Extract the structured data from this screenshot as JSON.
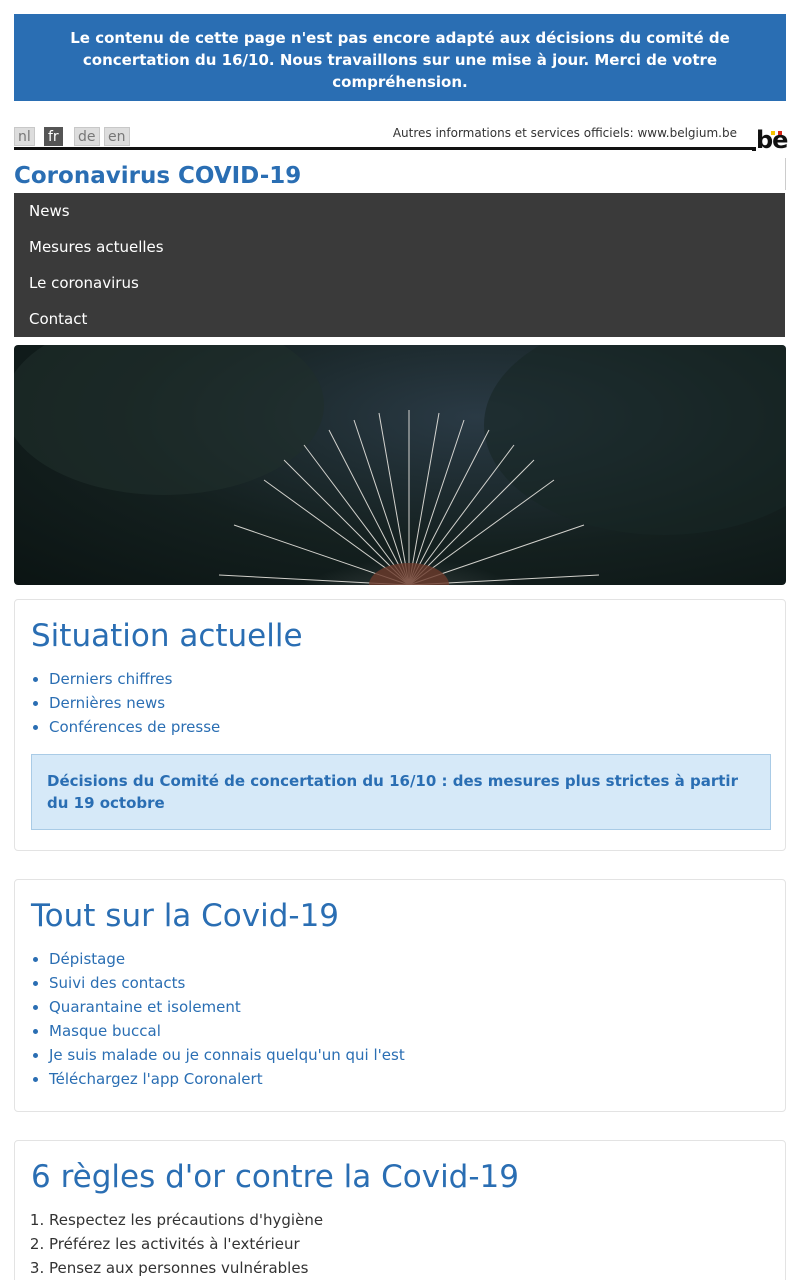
{
  "banner": {
    "text": "Le contenu de cette page n'est pas encore adapté aux décisions du comité de concertation du 16/10. Nous travaillons sur une mise à jour. Merci de votre compréhension."
  },
  "languages": [
    {
      "code": "nl",
      "active": false
    },
    {
      "code": "fr",
      "active": true
    },
    {
      "code": "de",
      "active": false
    },
    {
      "code": "en",
      "active": false
    }
  ],
  "header": {
    "official_label": "Autres informations et services officiels: ",
    "official_link": "www.belgium.be",
    "logo_text": "be",
    "site_title": "Coronavirus COVID-19"
  },
  "nav": {
    "items": [
      {
        "label": "News"
      },
      {
        "label": "Mesures actuelles"
      },
      {
        "label": "Le coronavirus"
      },
      {
        "label": "Contact"
      }
    ]
  },
  "situation": {
    "title": "Situation actuelle",
    "links": [
      {
        "label": "Derniers chiffres"
      },
      {
        "label": "Dernières news"
      },
      {
        "label": "Conférences de presse"
      }
    ],
    "notice": "Décisions du Comité de concertation du 16/10 : des mesures plus strictes à partir du 19 octobre"
  },
  "covid": {
    "title": "Tout sur la Covid-19",
    "links": [
      {
        "label": "Dépistage"
      },
      {
        "label": "Suivi des contacts"
      },
      {
        "label": "Quarantaine et isolement"
      },
      {
        "label": "Masque buccal"
      },
      {
        "label": "Je suis malade ou je connais quelqu'un qui l'est"
      },
      {
        "label": "Téléchargez l'app Coronalert"
      }
    ]
  },
  "rules": {
    "title": "6 règles d'or contre la Covid-19",
    "items": [
      {
        "label": "Respectez les précautions d'hygiène"
      },
      {
        "label": "Préférez les activités à l'extérieur"
      },
      {
        "label": "Pensez aux personnes vulnérables"
      }
    ]
  },
  "colors": {
    "brand_blue": "#2a6eb3",
    "nav_bg": "#3a3a3a",
    "notice_bg": "#d6e9f8"
  }
}
